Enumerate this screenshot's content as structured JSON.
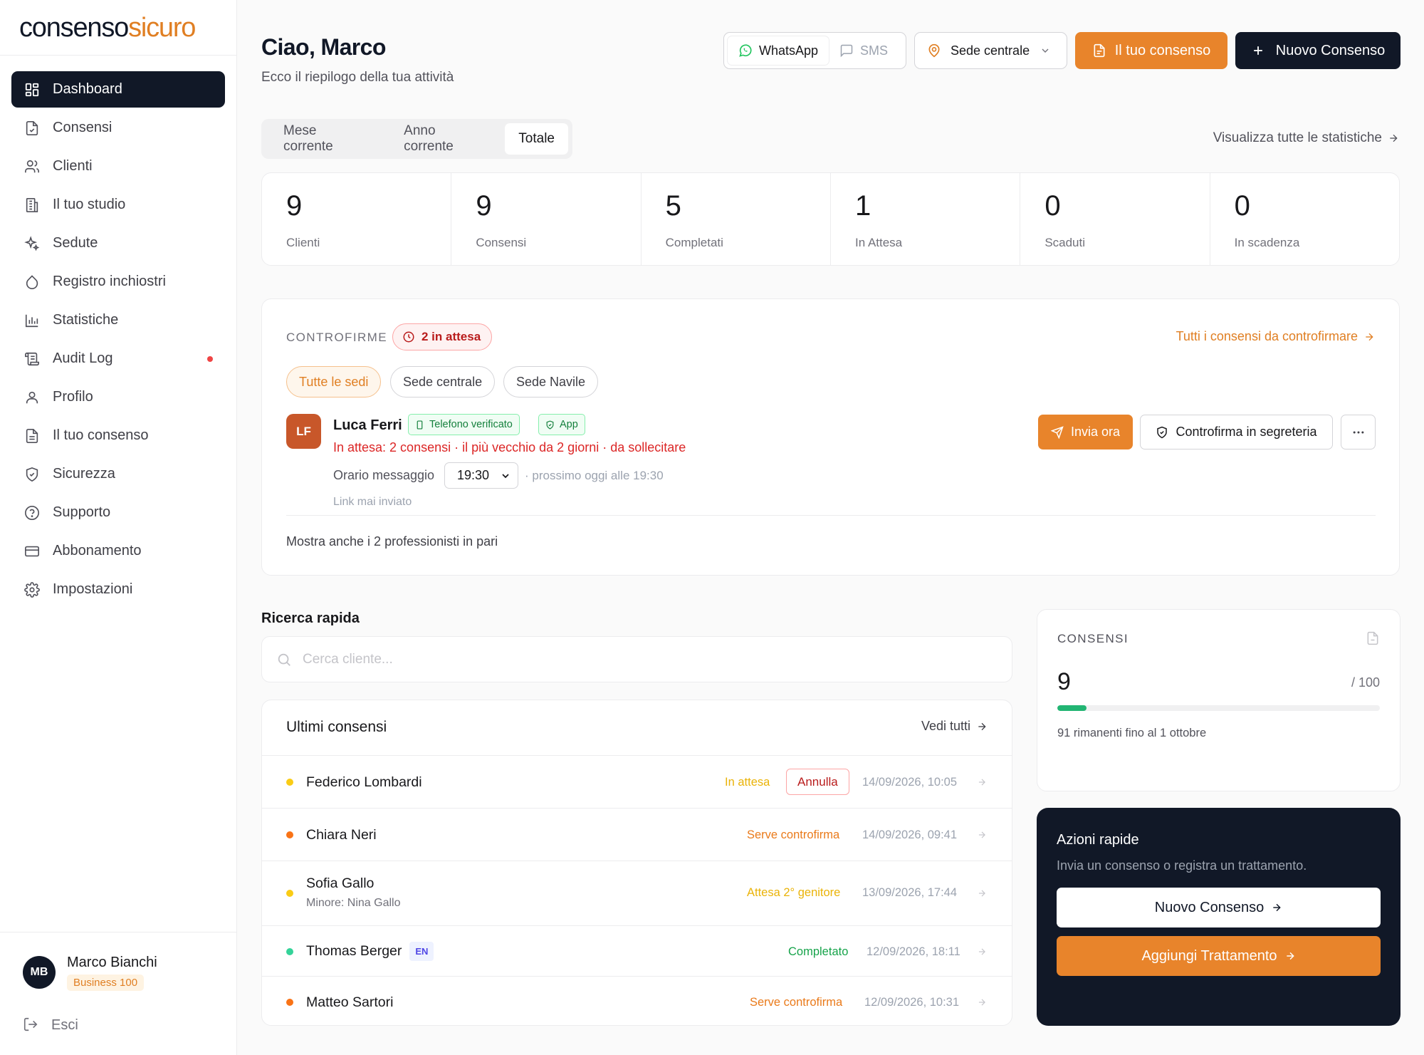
{
  "brand": {
    "logo_part1": "consenso",
    "logo_part2": "sicuro",
    "accent_color": "#e07f23"
  },
  "sidebar": {
    "items": [
      {
        "label": "Dashboard",
        "icon": "dashboard-icon",
        "active": true
      },
      {
        "label": "Consensi",
        "icon": "document-check-icon"
      },
      {
        "label": "Clienti",
        "icon": "users-icon"
      },
      {
        "label": "Il tuo studio",
        "icon": "building-icon"
      },
      {
        "label": "Sedute",
        "icon": "sparkles-icon"
      },
      {
        "label": "Registro inchiostri",
        "icon": "droplet-icon"
      },
      {
        "label": "Statistiche",
        "icon": "bar-chart-icon"
      },
      {
        "label": "Audit Log",
        "icon": "scroll-icon",
        "notification_dot": true
      },
      {
        "label": "Profilo",
        "icon": "user-icon"
      },
      {
        "label": "Il tuo consenso",
        "icon": "file-text-icon"
      },
      {
        "label": "Sicurezza",
        "icon": "shield-check-icon"
      },
      {
        "label": "Supporto",
        "icon": "help-circle-icon"
      },
      {
        "label": "Abbonamento",
        "icon": "credit-card-icon"
      },
      {
        "label": "Impostazioni",
        "icon": "gear-icon"
      }
    ],
    "user": {
      "initials": "MB",
      "name": "Marco Bianchi",
      "plan": "Business 100"
    },
    "logout_label": "Esci"
  },
  "header": {
    "greeting": "Ciao, Marco",
    "subtitle": "Ecco il riepilogo della tua attività",
    "channel": {
      "whatsapp": "WhatsApp",
      "sms": "SMS",
      "selected": "WhatsApp"
    },
    "sede": "Sede centrale",
    "btn_il_tuo_consenso": "Il tuo consenso",
    "btn_nuovo_consenso": "Nuovo Consenso"
  },
  "period_tabs": {
    "tabs": [
      "Mese corrente",
      "Anno corrente",
      "Totale"
    ],
    "active": "Totale"
  },
  "all_stats_link": "Visualizza tutte le statistiche",
  "stats": [
    {
      "value": "9",
      "label": "Clienti"
    },
    {
      "value": "9",
      "label": "Consensi"
    },
    {
      "value": "5",
      "label": "Completati"
    },
    {
      "value": "1",
      "label": "In Attesa"
    },
    {
      "value": "0",
      "label": "Scaduti"
    },
    {
      "value": "0",
      "label": "In scadenza"
    }
  ],
  "controfirme": {
    "title": "CONTROFIRME",
    "pending_badge": "2 in attesa",
    "all_link": "Tutti i consensi da controfirmare",
    "filters": [
      "Tutte le sedi",
      "Sede centrale",
      "Sede Navile"
    ],
    "active_filter": "Tutte le sedi",
    "entry": {
      "initials": "LF",
      "name": "Luca Ferri",
      "badge_phone": "Telefono verificato",
      "badge_app": "App",
      "pending_text": "In attesa: 2 consensi · il più vecchio da 2 giorni · da sollecitare",
      "time_label": "Orario messaggio",
      "time_value": "19:30",
      "next_text": "· prossimo oggi alle 19:30",
      "link_status": "Link mai inviato",
      "btn_send": "Invia ora",
      "btn_office": "Controfirma in segreteria"
    },
    "show_peers": "Mostra anche i 2 professionisti in pari"
  },
  "ricerca": {
    "title": "Ricerca rapida",
    "placeholder": "Cerca cliente..."
  },
  "ultimi": {
    "title": "Ultimi consensi",
    "view_all": "Vedi tutti",
    "rows": [
      {
        "name": "Federico Lombardi",
        "status": "In attesa",
        "status_color": "#eab308",
        "dot_color": "#facc15",
        "action": "Annulla",
        "date": "14/09/2026, 10:05"
      },
      {
        "name": "Chiara Neri",
        "status": "Serve controfirma",
        "status_color": "#ea7a1a",
        "dot_color": "#f97316",
        "date": "14/09/2026, 09:41"
      },
      {
        "name": "Sofia Gallo",
        "sub": "Minore: Nina Gallo",
        "status": "Attesa 2° genitore",
        "status_color": "#eab308",
        "dot_color": "#facc15",
        "date": "13/09/2026, 17:44"
      },
      {
        "name": "Thomas Berger",
        "lang": "EN",
        "status": "Completato",
        "status_color": "#16a34a",
        "dot_color": "#34d399",
        "date": "12/09/2026, 18:11"
      },
      {
        "name": "Matteo Sartori",
        "status": "Serve controfirma",
        "status_color": "#ea7a1a",
        "dot_color": "#f97316",
        "date": "12/09/2026, 10:31"
      }
    ]
  },
  "quota": {
    "title": "CONSENSI",
    "used": "9",
    "max_label": "/ 100",
    "progress_fraction": 0.09,
    "remaining_text": "91 rimanenti fino al 1 ottobre",
    "bar_color": "#22b573"
  },
  "azioni": {
    "title": "Azioni rapide",
    "subtitle": "Invia un consenso o registra un trattamento.",
    "btn_consenso": "Nuovo Consenso",
    "btn_trattamento": "Aggiungi Trattamento"
  }
}
